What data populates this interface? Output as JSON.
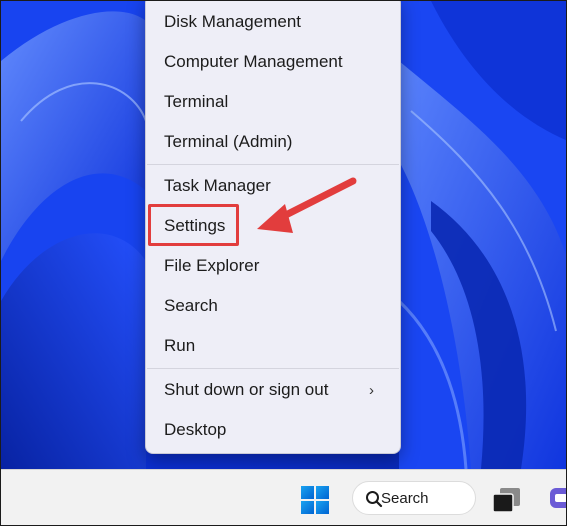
{
  "context_menu": {
    "items": [
      {
        "label": "Disk Management"
      },
      {
        "label": "Computer Management"
      },
      {
        "label": "Terminal"
      },
      {
        "label": "Terminal (Admin)"
      },
      {
        "label": "Task Manager"
      },
      {
        "label": "Settings"
      },
      {
        "label": "File Explorer"
      },
      {
        "label": "Search"
      },
      {
        "label": "Run"
      },
      {
        "label": "Shut down or sign out"
      },
      {
        "label": "Desktop"
      }
    ],
    "submenu_chevron": "›"
  },
  "annotation": {
    "highlight_color": "#e23d3d"
  },
  "taskbar": {
    "search_label": "Search",
    "icons": [
      "windows-start-icon",
      "search-icon",
      "task-view-icon",
      "chat-icon"
    ]
  },
  "colors": {
    "menu_background": "#eeeef7",
    "wallpaper_blue": "#1e49ff",
    "taskbar_background": "#f2f2f2"
  }
}
